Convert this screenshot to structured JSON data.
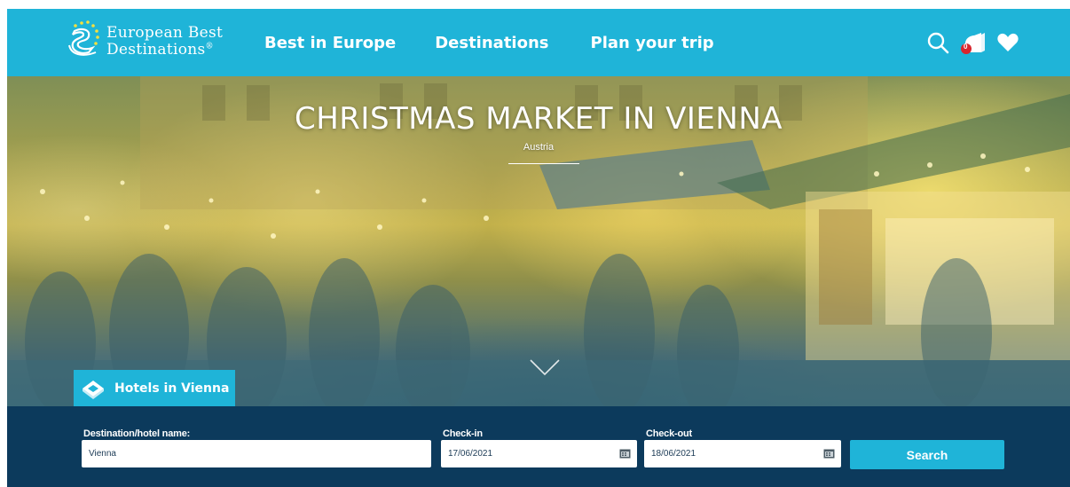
{
  "header": {
    "logo_line1": "European Best",
    "logo_line2": "Destinations",
    "logo_mark": "®",
    "nav": [
      {
        "label": "Best in Europe"
      },
      {
        "label": "Destinations"
      },
      {
        "label": "Plan your trip"
      }
    ],
    "icons": [
      "search-icon",
      "notification-icon",
      "heart-icon"
    ],
    "notification_count": "0",
    "brand_color": "#1fb4d8"
  },
  "hero": {
    "title": "CHRISTMAS MARKET IN VIENNA",
    "subtitle": "Austria",
    "scroll_icon": "chevron-down-icon"
  },
  "hotels": {
    "tab_label": "Hotels in Vienna",
    "tab_icon": "hotel-icon",
    "destination_label": "Destination/hotel name:",
    "destination_value": "Vienna",
    "checkin_label": "Check-in",
    "checkin_value": "17/06/2021",
    "checkout_label": "Check-out",
    "checkout_value": "18/06/2021",
    "calendar_icon": "calendar-icon",
    "search_label": "Search",
    "bar_color": "#0c3a5c"
  }
}
